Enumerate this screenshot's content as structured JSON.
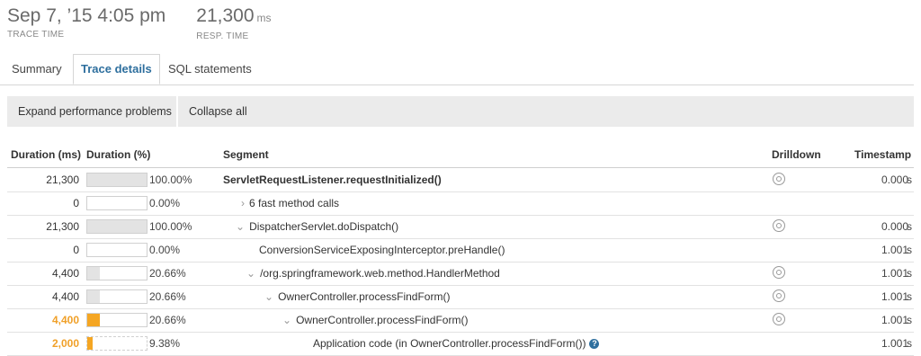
{
  "stats": {
    "trace_time": {
      "value": "Sep 7, ’15 4:05 pm",
      "label": "TRACE TIME"
    },
    "resp_time": {
      "value": "21,300",
      "unit": "ms",
      "label": "RESP. TIME"
    }
  },
  "tabs": [
    {
      "label": "Summary",
      "active": false
    },
    {
      "label": "Trace details",
      "active": true
    },
    {
      "label": "SQL statements",
      "active": false
    }
  ],
  "actions": {
    "expand": "Expand performance problems",
    "collapse": "Collapse all"
  },
  "table": {
    "headers": {
      "duration_ms": "Duration (ms)",
      "duration_pct": "Duration (%)",
      "segment": "Segment",
      "drilldown": "Drilldown",
      "timestamp": "Timestamp"
    },
    "rows": [
      {
        "ms": "21,300",
        "pct": "100.00%",
        "fill": 1.0,
        "segment": "ServletRequestListener.requestInitialized()",
        "bold": true,
        "chevron": "",
        "drill": true,
        "ts": "0.000",
        "unit": "s",
        "highlight": false
      },
      {
        "ms": "0",
        "pct": "0.00%",
        "fill": 0.0,
        "segment": "6 fast method calls",
        "bold": false,
        "chevron": "›",
        "drill": false,
        "ts": "",
        "unit": "",
        "highlight": false
      },
      {
        "ms": "21,300",
        "pct": "100.00%",
        "fill": 1.0,
        "segment": "DispatcherServlet.doDispatch()",
        "bold": false,
        "chevron": "⌄",
        "drill": true,
        "ts": "0.000",
        "unit": "s",
        "highlight": false
      },
      {
        "ms": "0",
        "pct": "0.00%",
        "fill": 0.0,
        "segment": "ConversionServiceExposingInterceptor.preHandle()",
        "bold": false,
        "chevron": "",
        "drill": false,
        "ts": "1.001",
        "unit": "s",
        "highlight": false
      },
      {
        "ms": "4,400",
        "pct": "20.66%",
        "fill": 0.2066,
        "segment": "/org.springframework.web.method.HandlerMethod",
        "bold": false,
        "chevron": "⌄",
        "drill": true,
        "ts": "1.001",
        "unit": "s",
        "highlight": false
      },
      {
        "ms": "4,400",
        "pct": "20.66%",
        "fill": 0.2066,
        "segment": "OwnerController.processFindForm()",
        "bold": false,
        "chevron": "⌄",
        "drill": true,
        "ts": "1.001",
        "unit": "s",
        "highlight": false
      },
      {
        "ms": "4,400",
        "pct": "20.66%",
        "fill": 0.2066,
        "segment": "OwnerController.processFindForm()",
        "bold": false,
        "chevron": "⌄",
        "drill": true,
        "ts": "1.001",
        "unit": "s",
        "highlight": true
      },
      {
        "ms": "2,000",
        "pct": "9.38%",
        "fill": 0.0938,
        "segment": "Application code (in OwnerController.processFindForm())",
        "bold": false,
        "chevron": "",
        "drill": false,
        "help": true,
        "ts": "1.001",
        "unit": "s",
        "highlight": true
      }
    ]
  },
  "icons": {
    "drill": "magnifier-icon",
    "help": "question-icon"
  },
  "colors": {
    "accent": "#2e6f9e",
    "highlight": "#f5a623"
  }
}
